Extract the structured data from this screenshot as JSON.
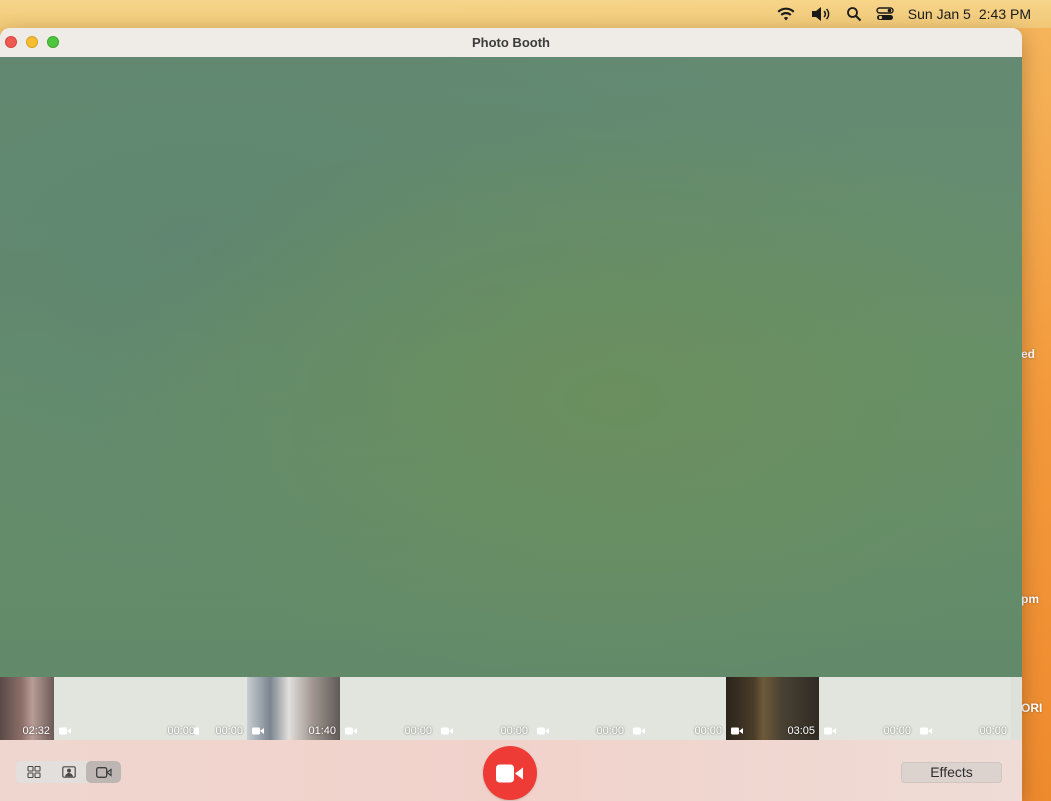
{
  "menubar": {
    "date": "Sun Jan 5",
    "time": "2:43 PM",
    "icons": [
      "wifi-icon",
      "volume-icon",
      "spotlight-search-icon",
      "control-center-icon"
    ]
  },
  "desktop": {
    "fragments": [
      "ed",
      "pm",
      "ORI"
    ]
  },
  "window": {
    "title": "Photo Booth"
  },
  "filmstrip": {
    "items": [
      {
        "duration": "02:32",
        "kind": "thumbnail"
      },
      {
        "duration": "00:00",
        "kind": "empty"
      },
      {
        "duration": "00:00",
        "kind": "empty"
      },
      {
        "duration": "01:40",
        "kind": "thumbnail"
      },
      {
        "duration": "00:00",
        "kind": "empty"
      },
      {
        "duration": "00:00",
        "kind": "empty"
      },
      {
        "duration": "00:00",
        "kind": "empty"
      },
      {
        "duration": "00:00",
        "kind": "empty"
      },
      {
        "duration": "03:05",
        "kind": "thumbnail"
      },
      {
        "duration": "00:00",
        "kind": "empty"
      },
      {
        "duration": "00:00",
        "kind": "empty"
      }
    ]
  },
  "toolbar": {
    "modes": [
      {
        "name": "four-up-photo",
        "icon": "grid-icon",
        "active": false
      },
      {
        "name": "single-photo",
        "icon": "portrait-icon",
        "active": false
      },
      {
        "name": "video",
        "icon": "video-camera-icon",
        "active": true
      }
    ],
    "record_icon": "video-camera-icon",
    "record_color": "#ee3b36",
    "effects_label": "Effects"
  }
}
